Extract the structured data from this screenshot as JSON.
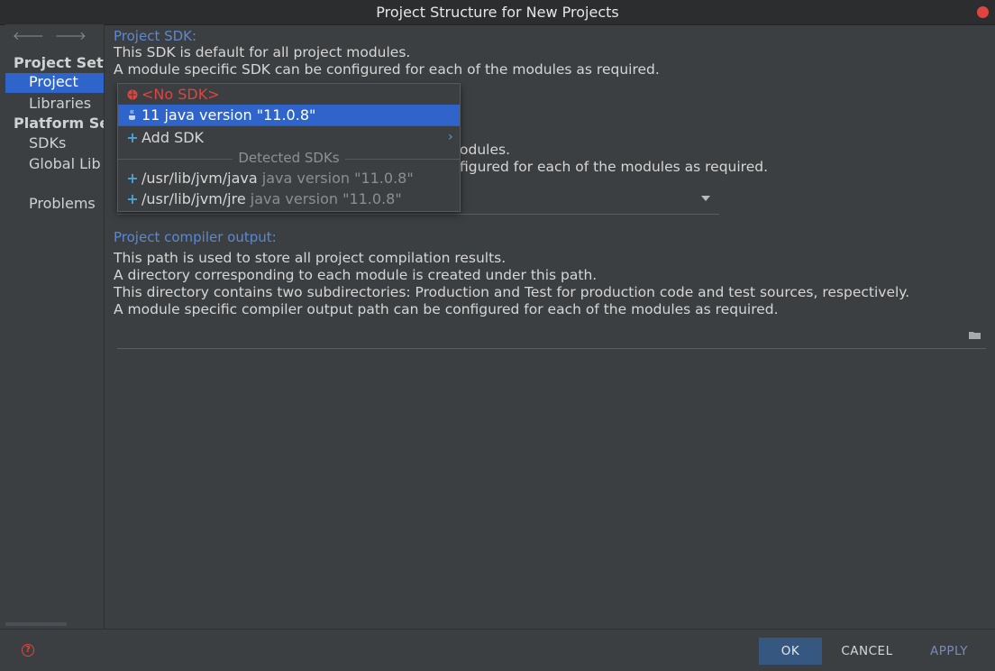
{
  "window": {
    "title": "Project Structure for New Projects"
  },
  "sidebar": {
    "nav": {
      "back": "🡐",
      "forward": "🡒"
    },
    "project_settings_header": "Project Setti",
    "platform_settings_header": "Platform Set",
    "items": {
      "project": "Project",
      "libraries": "Libraries",
      "sdks": "SDKs",
      "global_libraries": "Global Lib",
      "problems": "Problems"
    }
  },
  "sdk_section": {
    "title": "Project SDK:",
    "desc1": "This SDK is default for all project modules.",
    "desc2": "A module specific SDK can be configured for each of the modules as required."
  },
  "language_section": {
    "desc1_visible": "odules.",
    "desc2_visible": "figured for each of the modules as required."
  },
  "compiler_section": {
    "title": "Project compiler output:",
    "desc1": "This path is used to store all project compilation results.",
    "desc2": "A directory corresponding to each module is created under this path.",
    "desc3": "This directory contains two subdirectories: Production and Test for production code and test sources, respectively.",
    "desc4": "A module specific compiler output path can be configured for each of the modules as required.",
    "output_path_value": ""
  },
  "sdk_popup": {
    "no_sdk": "<No SDK>",
    "selected_sdk": "11 java version \"11.0.8\"",
    "add_sdk": "Add SDK",
    "detected_header": "Detected SDKs",
    "detected": [
      {
        "path": "/usr/lib/jvm/java",
        "version": "java version \"11.0.8\""
      },
      {
        "path": "/usr/lib/jvm/jre",
        "version": "java version \"11.0.8\""
      }
    ]
  },
  "footer": {
    "ok": "OK",
    "cancel": "CANCEL",
    "apply": "APPLY",
    "help": "?"
  },
  "colors": {
    "accent": "#2f65ca",
    "section_title": "#5c88d3",
    "error": "#e0443e",
    "link": "#4da1d6"
  }
}
